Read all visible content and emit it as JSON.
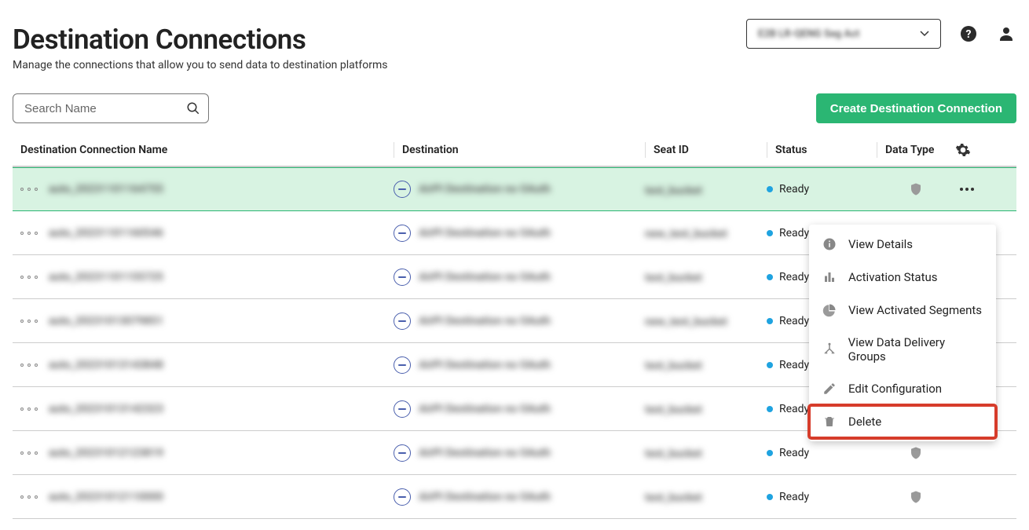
{
  "header": {
    "title": "Destination Connections",
    "subtitle": "Manage the connections that allow you to send data to destination platforms",
    "account_label": "E2B LR-QENG Seg Act"
  },
  "search": {
    "placeholder": "Search Name"
  },
  "create_button": "Create Destination Connection",
  "columns": {
    "name": "Destination Connection Name",
    "destination": "Destination",
    "seat": "Seat ID",
    "status": "Status",
    "type": "Data Type"
  },
  "rows": [
    {
      "name": "auto_20231101164755",
      "destination": "AirPI Destination no OAuth",
      "seat": "test_bucket",
      "status": "Ready"
    },
    {
      "name": "auto_20231101160546",
      "destination": "AirPI Destination no OAuth",
      "seat": "new_test_bucket",
      "status": "Ready"
    },
    {
      "name": "auto_20231101155725",
      "destination": "AirPI Destination no OAuth",
      "seat": "test_bucket",
      "status": "Ready"
    },
    {
      "name": "auto_20231013079851",
      "destination": "AirPI Destination no OAuth",
      "seat": "new_test_bucket",
      "status": "Ready"
    },
    {
      "name": "auto_20231013143848",
      "destination": "AirPI Destination no OAuth",
      "seat": "test_bucket",
      "status": "Ready"
    },
    {
      "name": "auto_20231013142323",
      "destination": "AirPI Destination no OAuth",
      "seat": "test_bucket",
      "status": "Ready"
    },
    {
      "name": "auto_20231012123819",
      "destination": "AirPI Destination no OAuth",
      "seat": "test_bucket",
      "status": "Ready"
    },
    {
      "name": "auto_20231012110000",
      "destination": "AirPI Destination no OAuth",
      "seat": "test_bucket",
      "status": "Ready"
    }
  ],
  "menu": {
    "view_details": "View Details",
    "activation_status": "Activation Status",
    "view_segments": "View Activated Segments",
    "view_groups": "View Data Delivery Groups",
    "edit": "Edit Configuration",
    "delete": "Delete"
  }
}
